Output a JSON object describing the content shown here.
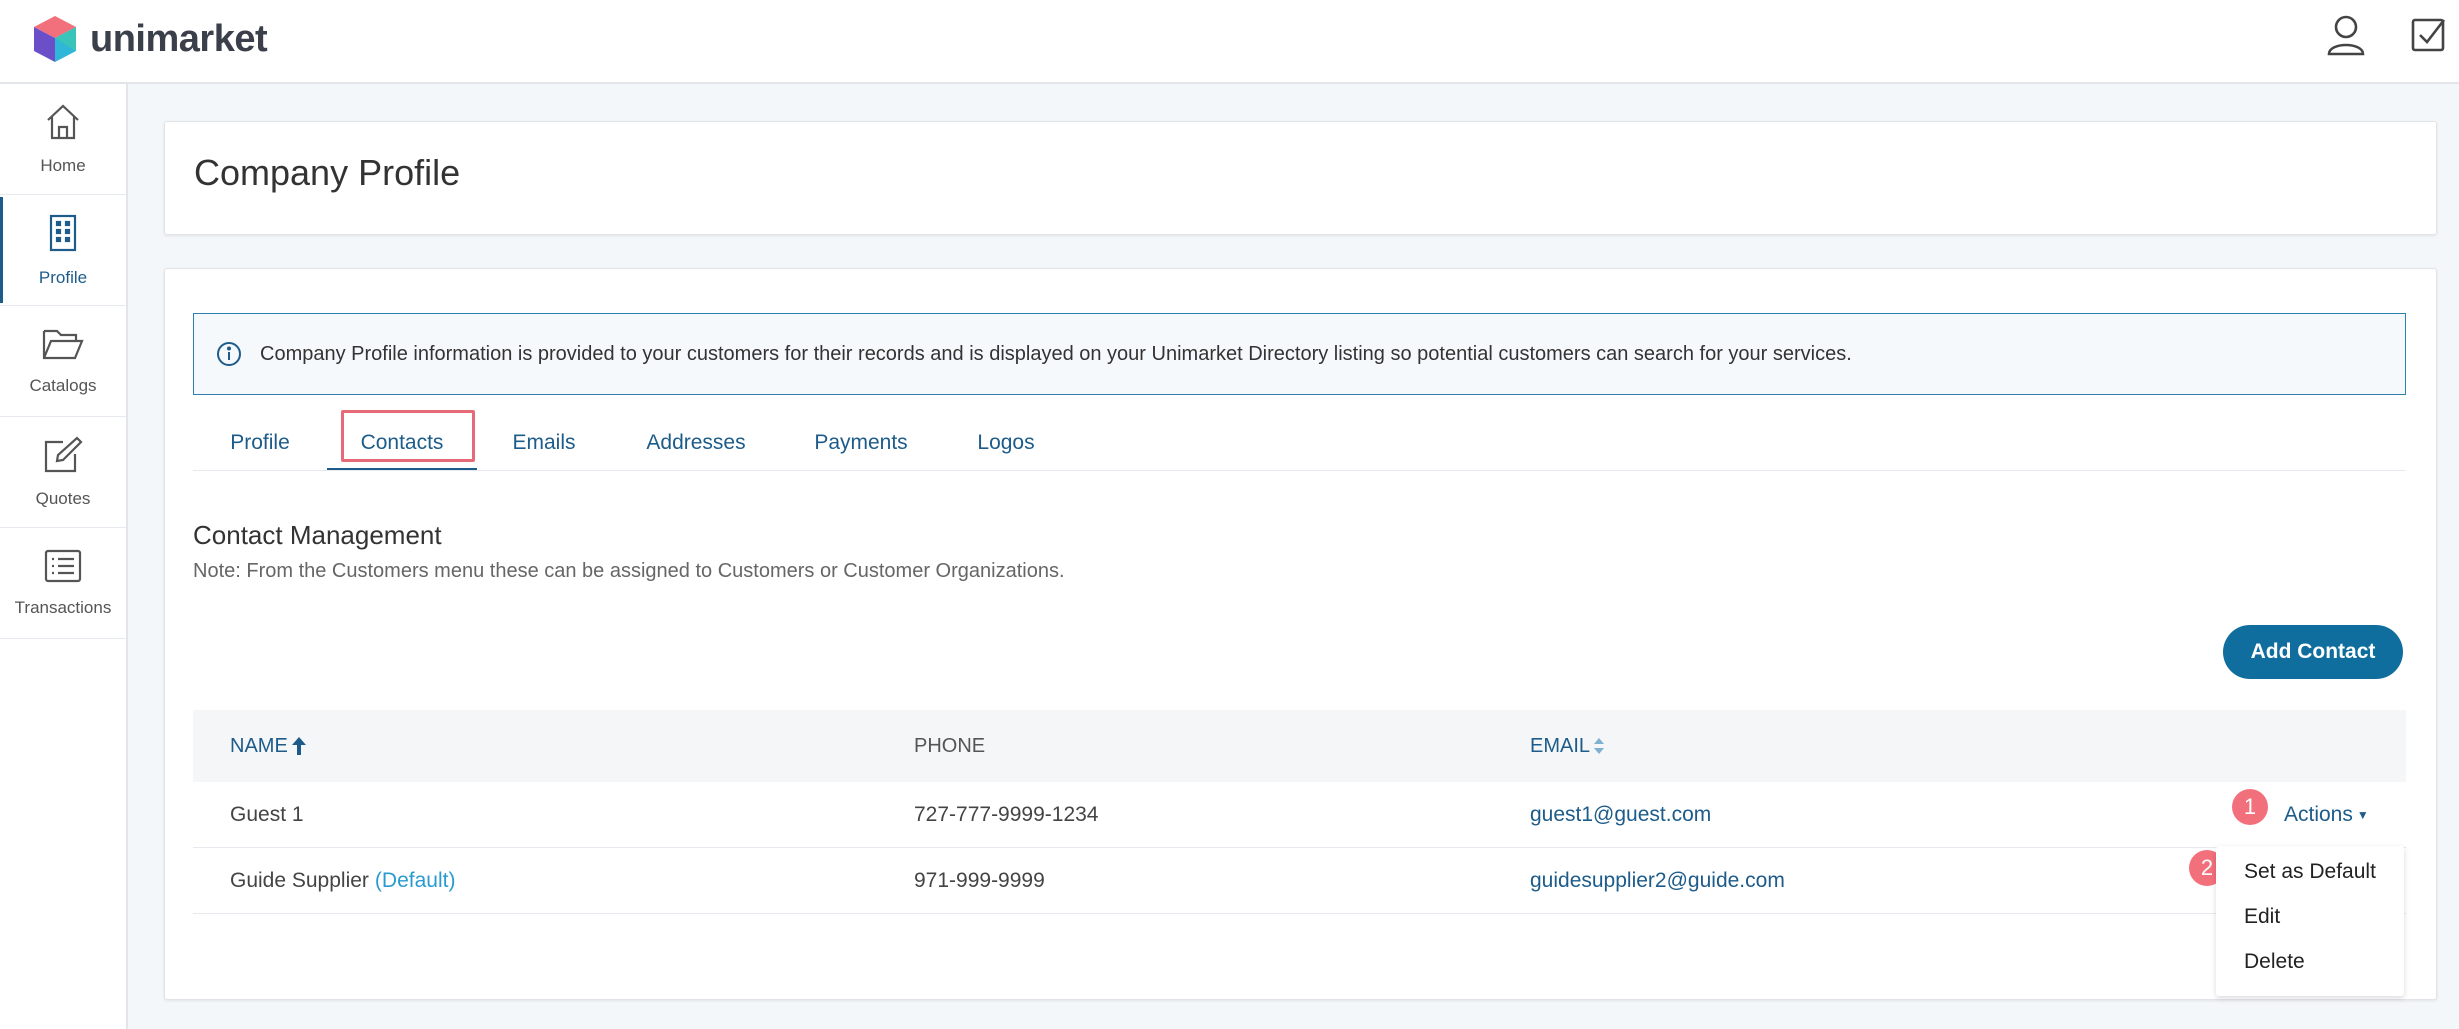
{
  "app": {
    "name": "unimarket",
    "accent": "#1d5c8a",
    "button_color": "#0f6e9e",
    "badge_color": "#f2707c"
  },
  "header": {
    "icons": [
      "user-icon",
      "checkbox-icon"
    ]
  },
  "sidebar": {
    "items": [
      {
        "label": "Home",
        "icon": "home-icon"
      },
      {
        "label": "Profile",
        "icon": "building-icon",
        "active": true
      },
      {
        "label": "Catalogs",
        "icon": "folder-icon"
      },
      {
        "label": "Quotes",
        "icon": "edit-icon"
      },
      {
        "label": "Transactions",
        "icon": "list-icon"
      }
    ]
  },
  "page": {
    "title": "Company Profile"
  },
  "info_banner": {
    "icon": "info-icon",
    "text": "Company Profile information is provided to your customers for their records and is displayed on your Unimarket Directory listing so potential customers can search for your services."
  },
  "tabs": [
    {
      "label": "Profile"
    },
    {
      "label": "Contacts",
      "active": true
    },
    {
      "label": "Emails"
    },
    {
      "label": "Addresses"
    },
    {
      "label": "Payments"
    },
    {
      "label": "Logos"
    }
  ],
  "contacts": {
    "title": "Contact Management",
    "note": "Note: From the Customers menu these can be assigned to Customers or Customer Organizations.",
    "add_button": "Add Contact",
    "columns": {
      "name": "NAME",
      "phone": "PHONE",
      "email": "EMAIL"
    },
    "rows": [
      {
        "name": "Guest 1",
        "default": "",
        "phone": "727-777-9999-1234",
        "email": "guest1@guest.com"
      },
      {
        "name": "Guide Supplier",
        "default": "(Default)",
        "phone": "971-999-9999",
        "email": "guidesupplier2@guide.com"
      }
    ],
    "actions_label": "Actions",
    "actions_menu": [
      "Set as Default",
      "Edit",
      "Delete"
    ]
  },
  "step_badges": [
    "1",
    "2"
  ]
}
